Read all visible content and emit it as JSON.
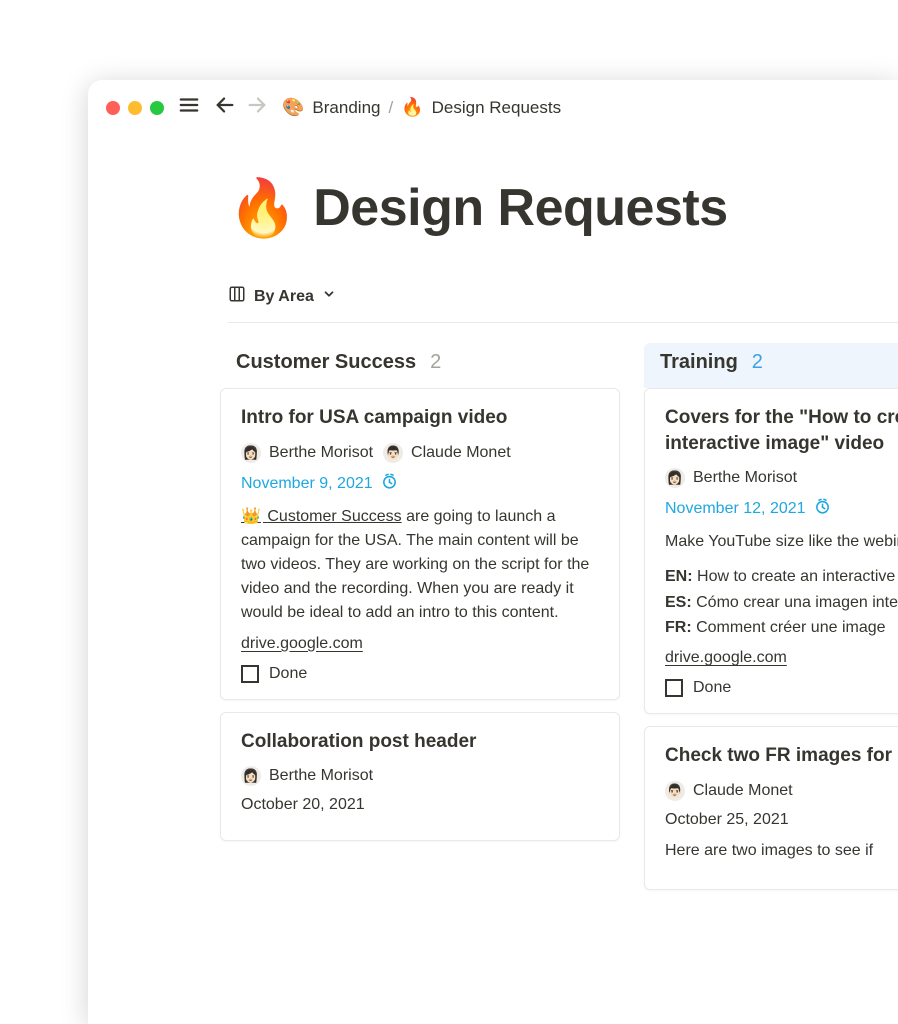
{
  "breadcrumb": {
    "parent_emoji": "🎨",
    "parent_label": "Branding",
    "separator": "/",
    "current_emoji": "🔥",
    "current_label": "Design Requests"
  },
  "page": {
    "title_emoji": "🔥",
    "title": "Design Requests",
    "view_label": "By Area"
  },
  "columns": {
    "customer_success": {
      "title": "Customer Success",
      "count": "2"
    },
    "training": {
      "title": "Training",
      "count": "2"
    }
  },
  "cards": {
    "intro_usa": {
      "title": "Intro for USA campaign video",
      "person1": "Berthe Morisot",
      "person2": "Claude Monet",
      "date": "November 9, 2021",
      "mention_emoji": "👑",
      "mention_text": "Customer Success",
      "body": " are going to launch a campaign for the USA. The main content will be two videos. They are working on the script for the video and the recording. When you are ready it would be ideal to add an intro to this content.",
      "link": "drive.google.com",
      "done_label": "Done"
    },
    "collab_post": {
      "title": "Collaboration post header",
      "person1": "Berthe Morisot",
      "date": "October 20, 2021"
    },
    "covers_howto": {
      "title": "Covers for the \"How to create an interactive image\" video",
      "person1": "Berthe Morisot",
      "date": "November 12, 2021",
      "body_intro": "Make YouTube size like the webinar, but creative.",
      "en_label": "EN:",
      "en_text": " How to create an interactive",
      "es_label": "ES:",
      "es_text": " Cómo crear una imagen interactiva",
      "fr_label": "FR:",
      "fr_text": " Comment créer une image",
      "link": "drive.google.com",
      "done_label": "Done"
    },
    "check_fr": {
      "title": "Check two FR images for",
      "person1": "Claude Monet",
      "date": "October 25, 2021",
      "body": "Here are two images to see if"
    }
  }
}
